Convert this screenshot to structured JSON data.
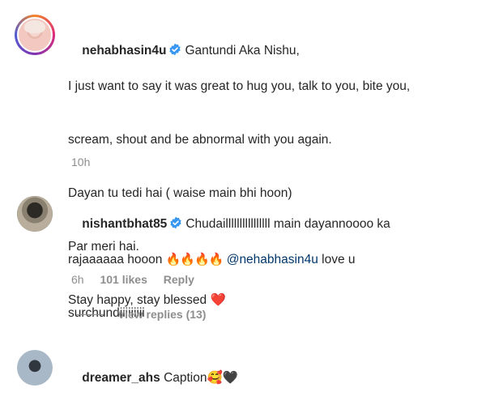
{
  "comments": [
    {
      "username": "nehabhasin4u",
      "lines": [
        "Gantundi Aka Nishu,",
        "I just want to say it was great to hug you, talk to you, bite you,",
        "scream, shout and be abnormal with you again.",
        "Dayan tu tedi hai ( waise main bhi hoon)",
        "Par meri hai.",
        "Stay happy, stay blessed ❤️"
      ],
      "time": "10h"
    },
    {
      "username": "nishantbhat85",
      "text_start": "Chudaillllllllllllllll main dayannoooo ka",
      "text_line2_start": "rajaaaaaa hooon ",
      "fire": "🔥🔥🔥🔥",
      "mention": "@nehabhasin4u",
      "text_after_mention": " love u",
      "text_line3": "surchundiiiiiiiii",
      "time": "6h",
      "likes": "101 likes",
      "reply_label": "Reply"
    },
    {
      "username": "dreamer_ahs",
      "text": "Caption🥰🖤"
    }
  ],
  "view_replies": "View replies (13)",
  "colors": {
    "verified": "#3897f0",
    "mention": "#00376b",
    "meta": "#8e8e8e"
  }
}
